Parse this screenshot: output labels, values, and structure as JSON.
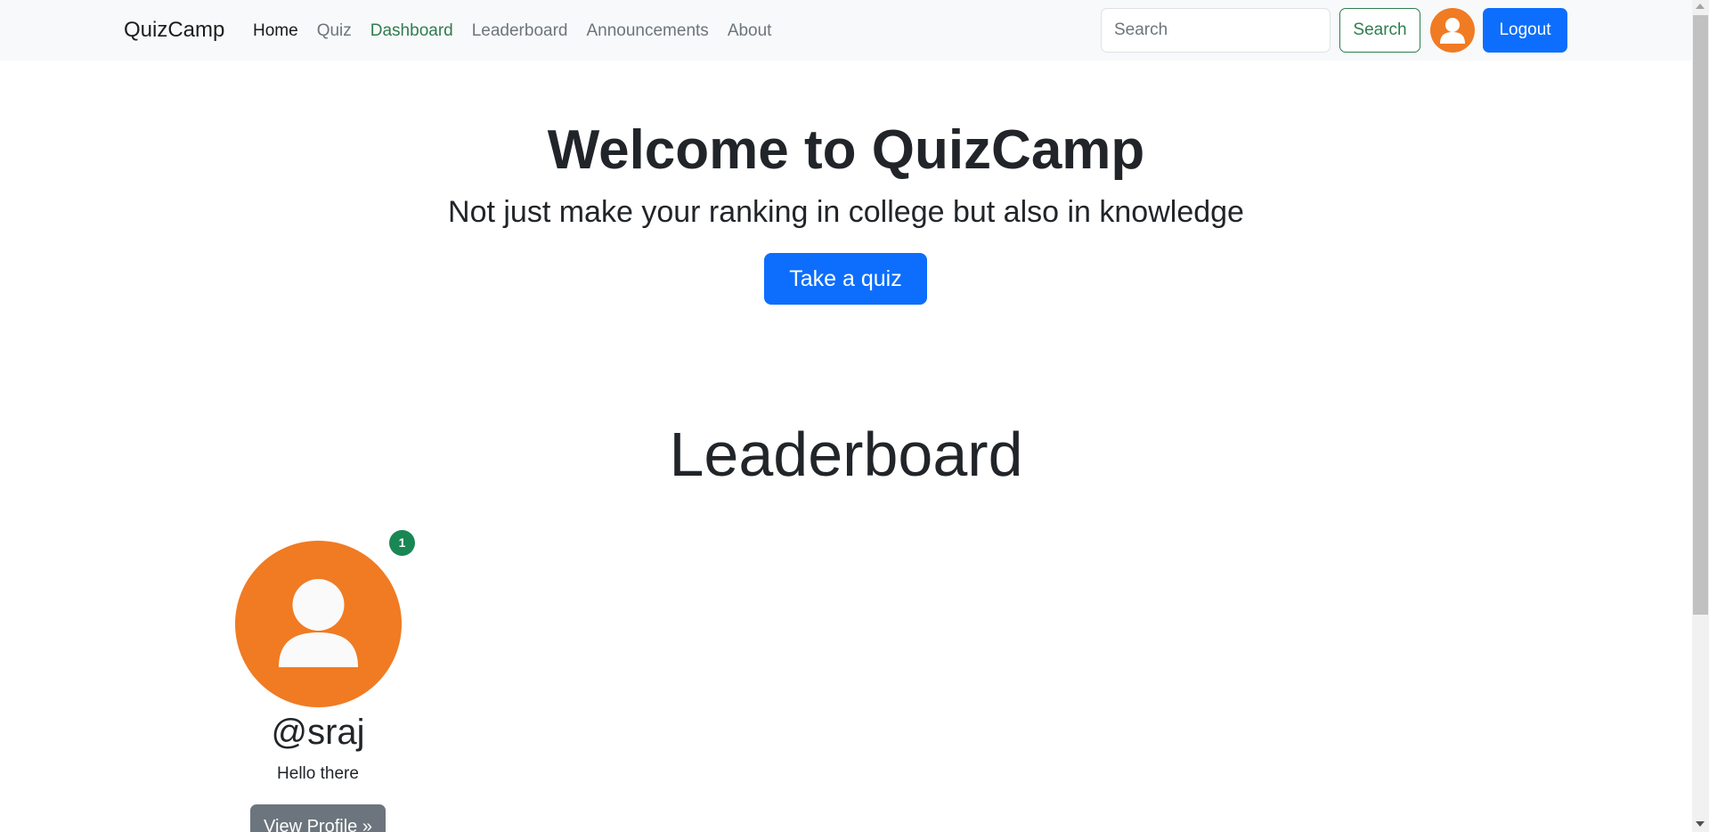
{
  "navbar": {
    "brand": "QuizCamp",
    "links": [
      {
        "label": "Home"
      },
      {
        "label": "Quiz"
      },
      {
        "label": "Dashboard"
      },
      {
        "label": "Leaderboard"
      },
      {
        "label": "Announcements"
      },
      {
        "label": "About"
      }
    ],
    "search_placeholder": "Search",
    "search_button": "Search",
    "logout_button": "Logout"
  },
  "hero": {
    "title": "Welcome to QuizCamp",
    "subtitle": "Not just make your ranking in college but also in knowledge",
    "cta": "Take a quiz"
  },
  "leaderboard": {
    "title": "Leaderboard",
    "entries": [
      {
        "rank": "1",
        "username": "@sraj",
        "bio": "Hello there",
        "button": "View Profile »"
      }
    ]
  },
  "colors": {
    "primary": "#0d6efd",
    "success": "#198754",
    "avatar": "#f07b23",
    "secondary": "#6c757d"
  }
}
